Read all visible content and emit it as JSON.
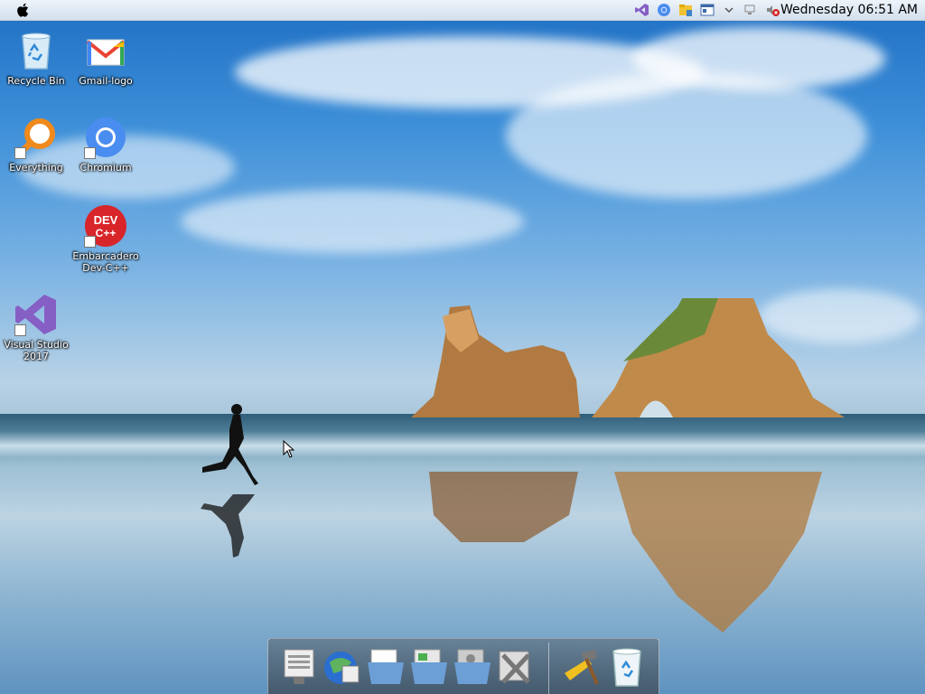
{
  "menubar": {
    "clock": "Wednesday 06:51 AM"
  },
  "desktop_icons": [
    {
      "label": "Recycle Bin",
      "icon": "recycle-bin-icon"
    },
    {
      "label": "Gmail-logo",
      "icon": "gmail-icon"
    },
    {
      "label": "Everything",
      "icon": "search-magnifier-icon"
    },
    {
      "label": "Chromium",
      "icon": "chromium-icon"
    },
    {
      "label": "Embarcadero Dev-C++",
      "icon": "devcpp-icon",
      "badge_text": "DEV C++"
    },
    {
      "label": "Visual Studio 2017",
      "icon": "visual-studio-icon"
    }
  ],
  "tray_icons": [
    "visual-studio-icon",
    "chromium-icon",
    "file-manager-icon",
    "window-icon",
    "chevron-down-icon",
    "network-icon",
    "volume-muted-icon"
  ],
  "dock_items": [
    {
      "name": "system-preferences-icon"
    },
    {
      "name": "browser-globe-icon"
    },
    {
      "name": "documents-folder-icon"
    },
    {
      "name": "downloads-folder-icon"
    },
    {
      "name": "pictures-folder-icon"
    },
    {
      "name": "utilities-tools-icon"
    },
    {
      "name": "developer-hammer-icon"
    },
    {
      "name": "trash-icon"
    }
  ],
  "colors": {
    "devcpp_red": "#d8252a",
    "vs_purple": "#865fc5",
    "chromium_blue": "#4a8df0",
    "everything_orange": "#f08a1c"
  }
}
